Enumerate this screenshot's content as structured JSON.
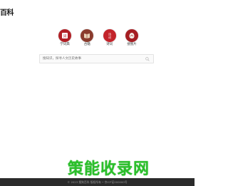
{
  "header": {
    "logo_text": "百科"
  },
  "quick_links": [
    {
      "label": "学词典",
      "icon": "dictionary-icon",
      "glyph": "词典",
      "color": "#b11f25"
    },
    {
      "label": "古籍",
      "icon": "ancient-book-icon",
      "glyph": "古",
      "color": "#8a3b2d"
    },
    {
      "label": "诗词",
      "icon": "poetry-icon",
      "glyph": "诗词",
      "color": "#c3242b"
    },
    {
      "label": "搜图片",
      "icon": "image-search-icon",
      "glyph": "图",
      "color": "#a51d22"
    }
  ],
  "search": {
    "placeholder": "搜知识，探寻人文历史故事",
    "value": ""
  },
  "footer": {
    "text": "© 2023 搜狗百科 版权所有 • 京ICP证000000号"
  },
  "watermark": {
    "text": "策能收录网"
  }
}
